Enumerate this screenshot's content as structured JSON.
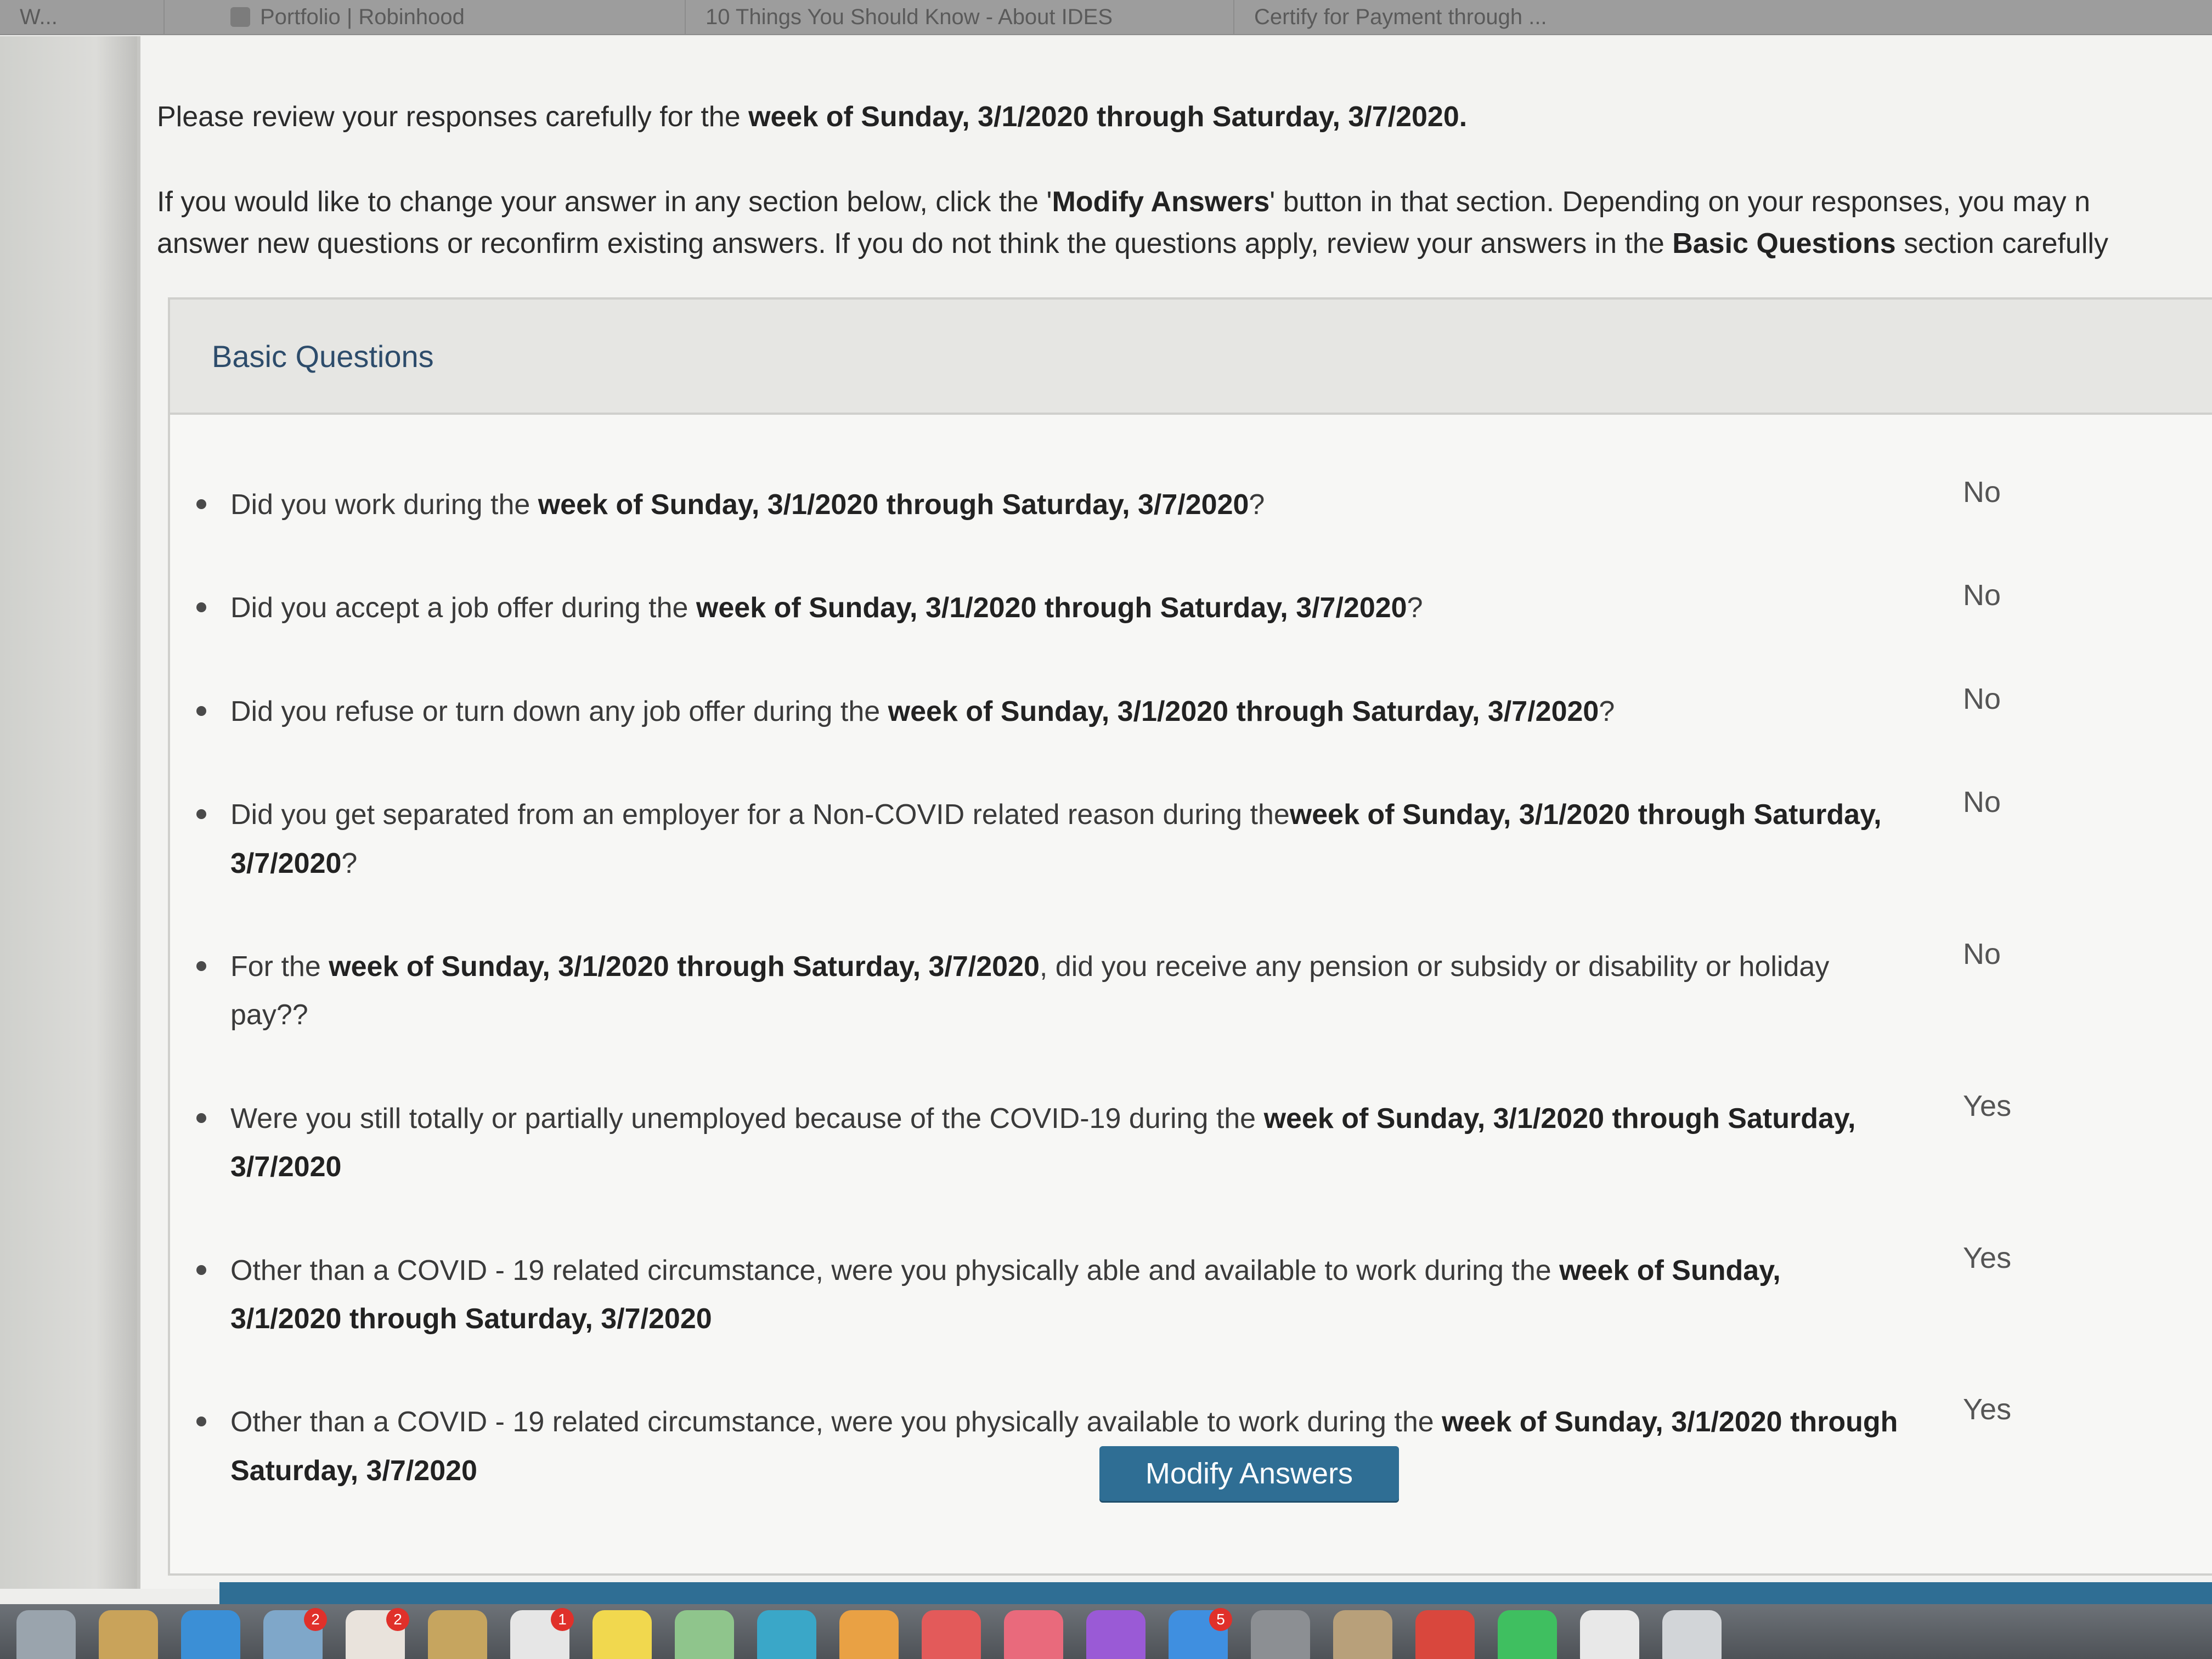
{
  "browser": {
    "tabs": [
      {
        "label": "W..."
      },
      {
        "label": "Portfolio | Robinhood"
      },
      {
        "label": "10 Things You Should Know - About IDES"
      },
      {
        "label": "Certify for Payment through ..."
      }
    ]
  },
  "intro": {
    "line1_pre": "Please review your responses carefully for the ",
    "line1_bold": "week of Sunday, 3/1/2020 through Saturday, 3/7/2020.",
    "p2_a": "If you would like to change your answer in any section below, click the '",
    "p2_bold1": "Modify Answers",
    "p2_b": "' button in that section. Depending on your responses, you may n",
    "p2_c": "answer new questions or reconfirm existing answers. If you do not think the questions apply, review your answers in the ",
    "p2_bold2": "Basic Questions",
    "p2_d": " section carefully"
  },
  "section": {
    "title": "Basic Questions",
    "questions": [
      {
        "pre": "Did you work during the ",
        "bold": "week of Sunday, 3/1/2020 through Saturday, 3/7/2020",
        "post": "?",
        "answer": "No"
      },
      {
        "pre": "Did you accept a job offer during the ",
        "bold": "week of Sunday, 3/1/2020 through Saturday, 3/7/2020",
        "post": "?",
        "answer": "No"
      },
      {
        "pre": "Did you refuse or turn down any job offer during the ",
        "bold": "week of Sunday, 3/1/2020 through Saturday, 3/7/2020",
        "post": "?",
        "answer": "No"
      },
      {
        "pre": "Did you get separated from an employer for a Non-COVID related reason during the",
        "bold": "week of Sunday, 3/1/2020 through Saturday, 3/7/2020",
        "post": "?",
        "answer": "No"
      },
      {
        "pre": "For the ",
        "bold": "week of Sunday, 3/1/2020 through Saturday, 3/7/2020",
        "post": ", did you receive any pension or subsidy or disability or holiday pay??",
        "answer": "No"
      },
      {
        "pre": "Were you still totally or partially unemployed because of the COVID-19 during the ",
        "bold": "week of Sunday, 3/1/2020 through Saturday, 3/7/2020",
        "post": "",
        "answer": "Yes"
      },
      {
        "pre": "Other than a COVID - 19 related circumstance, were you physically able and available to work during the ",
        "bold": "week of Sunday, 3/1/2020 through Saturday, 3/7/2020",
        "post": "",
        "answer": "Yes"
      },
      {
        "pre": "Other than a COVID - 19 related circumstance, were you physically available to work during the ",
        "bold": "week of Sunday, 3/1/2020 through Saturday, 3/7/2020",
        "post": "",
        "answer": "Yes"
      }
    ],
    "modify_label": "Modify Answers"
  },
  "dock": {
    "apps": [
      {
        "icon": "launchpad-icon",
        "color": "#9aa4ad",
        "badge": ""
      },
      {
        "icon": "finder-icon",
        "color": "#c9a35a",
        "badge": ""
      },
      {
        "icon": "safari-icon",
        "color": "#3b8fd6",
        "badge": ""
      },
      {
        "icon": "mail-icon",
        "color": "#7fa7c9",
        "badge": "2"
      },
      {
        "icon": "calendar-icon",
        "color": "#e9e3dc",
        "badge": "2"
      },
      {
        "icon": "notes-icon",
        "color": "#c6a55f",
        "badge": ""
      },
      {
        "icon": "reminders-icon",
        "color": "#e6e6e6",
        "badge": "1"
      },
      {
        "icon": "stickies-icon",
        "color": "#f1d84e",
        "badge": ""
      },
      {
        "icon": "maps-icon",
        "color": "#8fc58c",
        "badge": ""
      },
      {
        "icon": "messages-icon",
        "color": "#3aa7c8",
        "badge": ""
      },
      {
        "icon": "photos-icon",
        "color": "#e9a144",
        "badge": ""
      },
      {
        "icon": "news-icon",
        "color": "#e35a5a",
        "badge": ""
      },
      {
        "icon": "music-icon",
        "color": "#e96a7c",
        "badge": ""
      },
      {
        "icon": "podcasts-icon",
        "color": "#9a5ad6",
        "badge": ""
      },
      {
        "icon": "app-store-icon",
        "color": "#3f8fe0",
        "badge": "5"
      },
      {
        "icon": "system-preferences-icon",
        "color": "#8c8f93",
        "badge": ""
      },
      {
        "icon": "preview-icon",
        "color": "#b8a07a",
        "badge": ""
      },
      {
        "icon": "chrome-icon",
        "color": "#d9473d",
        "badge": ""
      },
      {
        "icon": "robinhood-icon",
        "color": "#3fbf60",
        "badge": ""
      },
      {
        "icon": "documents-icon",
        "color": "#e8e8e8",
        "badge": ""
      },
      {
        "icon": "trash-icon",
        "color": "#d2d5d8",
        "badge": ""
      }
    ]
  }
}
